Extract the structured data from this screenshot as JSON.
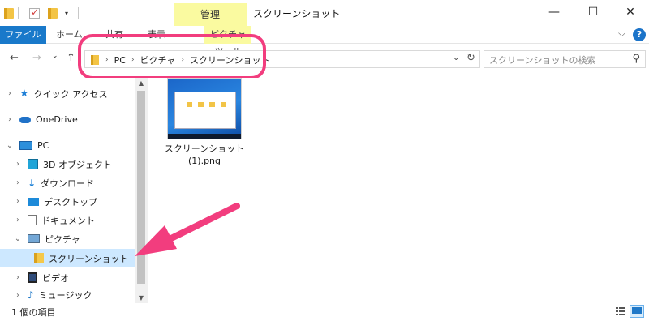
{
  "title_bar": {
    "manage_tab": "管理",
    "window_title": "スクリーンショット",
    "controls": [
      "—",
      "☐",
      "✕"
    ]
  },
  "ribbon": {
    "file_tab": "ファイル",
    "tabs": [
      "ホーム",
      "共有",
      "表示"
    ],
    "contextual_tab": "ピクチャ ツール"
  },
  "address": {
    "crumbs": [
      "PC",
      "ピクチャ",
      "スクリーンショット"
    ]
  },
  "search": {
    "placeholder": "スクリーンショットの検索"
  },
  "nav_pane": {
    "items": [
      {
        "label": "クイック アクセス",
        "icon": "star-icon"
      },
      {
        "label": "OneDrive",
        "icon": "cloud-icon"
      },
      {
        "label": "PC",
        "icon": "pc-icon"
      },
      {
        "label": "3D オブジェクト",
        "icon": "cube-icon"
      },
      {
        "label": "ダウンロード",
        "icon": "download-icon"
      },
      {
        "label": "デスクトップ",
        "icon": "desktop-icon"
      },
      {
        "label": "ドキュメント",
        "icon": "document-icon"
      },
      {
        "label": "ピクチャ",
        "icon": "pictures-icon"
      },
      {
        "label": "スクリーンショット",
        "icon": "folder-icon"
      },
      {
        "label": "ビデオ",
        "icon": "video-icon"
      },
      {
        "label": "ミュージック",
        "icon": "music-icon"
      }
    ]
  },
  "files": [
    {
      "name_line1": "スクリーンショット",
      "name_line2": "(1).png"
    }
  ],
  "status": {
    "count_text": "1 個の項目"
  },
  "colors": {
    "accent": "#1979ca",
    "highlight": "#f23d7e",
    "manage_tab_bg": "#fafaa0",
    "selected_item_bg": "#cde8ff"
  }
}
